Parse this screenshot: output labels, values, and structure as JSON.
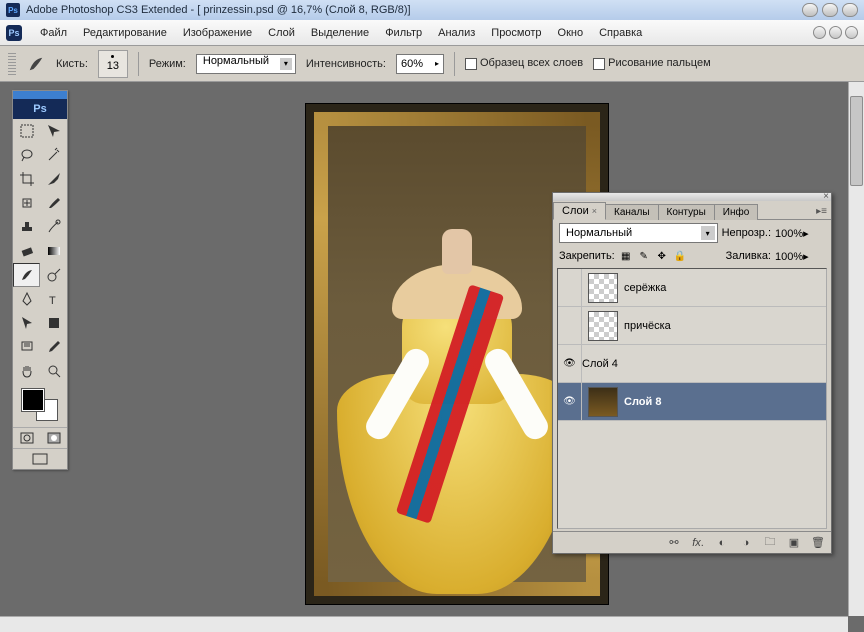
{
  "title": "Adobe Photoshop CS3 Extended - [ prinzessin.psd @ 16,7% (Слой 8, RGB/8)]",
  "menu": [
    "Файл",
    "Редактирование",
    "Изображение",
    "Слой",
    "Выделение",
    "Фильтр",
    "Анализ",
    "Просмотр",
    "Окно",
    "Справка"
  ],
  "options": {
    "brush_label": "Кисть:",
    "brush_size": "13",
    "mode_label": "Режим:",
    "mode_value": "Нормальный",
    "strength_label": "Интенсивность:",
    "strength_value": "60%",
    "sample_all": "Образец всех слоев",
    "finger_paint": "Рисование пальцем"
  },
  "layers_panel": {
    "tabs": [
      "Слои",
      "Каналы",
      "Контуры",
      "Инфо"
    ],
    "active_tab": "Слои",
    "blend_mode": "Нормальный",
    "opacity_label": "Непрозр.:",
    "opacity_value": "100%",
    "lock_label": "Закрепить:",
    "fill_label": "Заливка:",
    "fill_value": "100%",
    "layers": [
      {
        "name": "серёжка",
        "visible": false,
        "thumb": "checker"
      },
      {
        "name": "причёска",
        "visible": false,
        "thumb": "checker"
      },
      {
        "name": "Слой 4",
        "visible": true,
        "thumb": "doc"
      },
      {
        "name": "Слой 8",
        "visible": true,
        "thumb": "doc8",
        "selected": true
      }
    ]
  }
}
